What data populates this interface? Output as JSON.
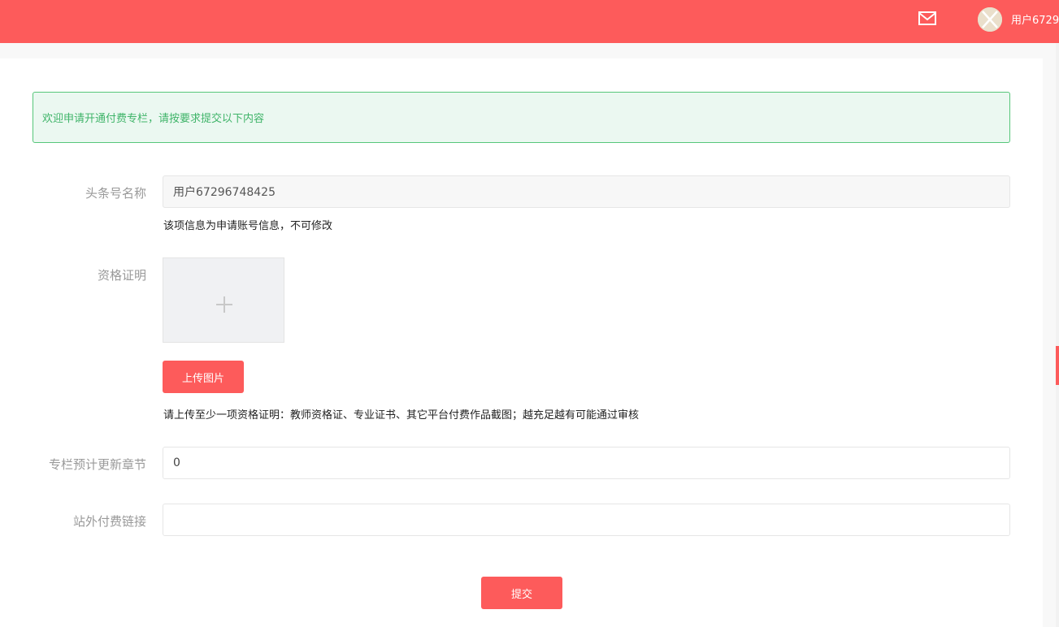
{
  "header": {
    "mail_icon": "mail-icon",
    "username": "用户6729"
  },
  "notice": {
    "text": "欢迎申请开通付费专栏，请按要求提交以下内容"
  },
  "form": {
    "account_name": {
      "label": "头条号名称",
      "value": "用户67296748425",
      "hint": "该项信息为申请账号信息，不可修改"
    },
    "qualification": {
      "label": "资格证明",
      "plus_icon": "plus-icon",
      "upload_label": "上传图片",
      "hint": "请上传至少一项资格证明：教师资格证、专业证书、其它平台付费作品截图；越充足越有可能通过审核"
    },
    "chapters": {
      "label": "专栏预计更新章节",
      "value": "0"
    },
    "external_link": {
      "label": "站外付费链接",
      "value": ""
    },
    "submit_label": "提交"
  },
  "colors": {
    "brand": "#fd5b5b",
    "notice_bg": "#ebf8f1",
    "notice_border": "#56c67a",
    "notice_text": "#3fb469"
  }
}
